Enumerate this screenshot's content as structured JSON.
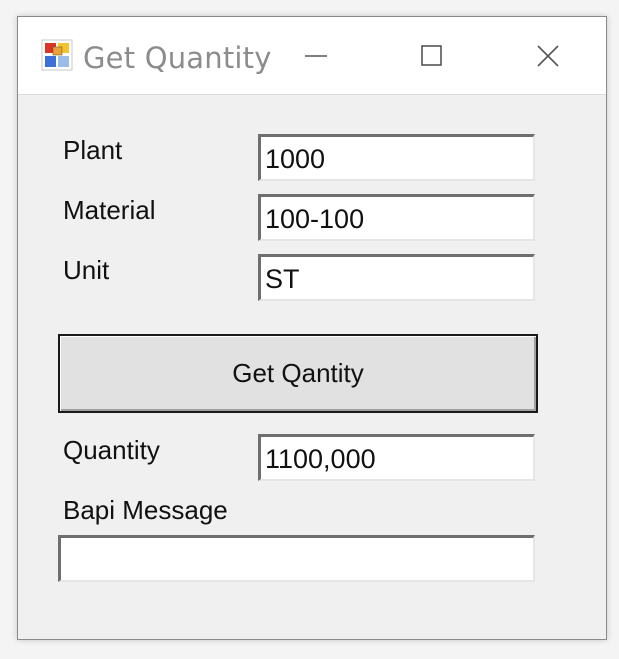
{
  "window": {
    "title": "Get Quantity",
    "icon": "winforms-app-icon",
    "controls": {
      "minimize_icon": "minimize-icon",
      "maximize_icon": "maximize-icon",
      "close_icon": "close-icon"
    }
  },
  "form": {
    "plant": {
      "label": "Plant",
      "value": "1000"
    },
    "material": {
      "label": "Material",
      "value": "100-100"
    },
    "unit": {
      "label": "Unit",
      "value": "ST"
    },
    "get_button_label": "Get Qantity",
    "quantity": {
      "label": "Quantity",
      "value": "1100,000"
    },
    "bapi_message": {
      "label": "Bapi Message",
      "value": ""
    }
  },
  "colors": {
    "title_text": "#8c8c8c",
    "window_bg": "#f0f0f0",
    "titlebar_bg": "#ffffff"
  }
}
